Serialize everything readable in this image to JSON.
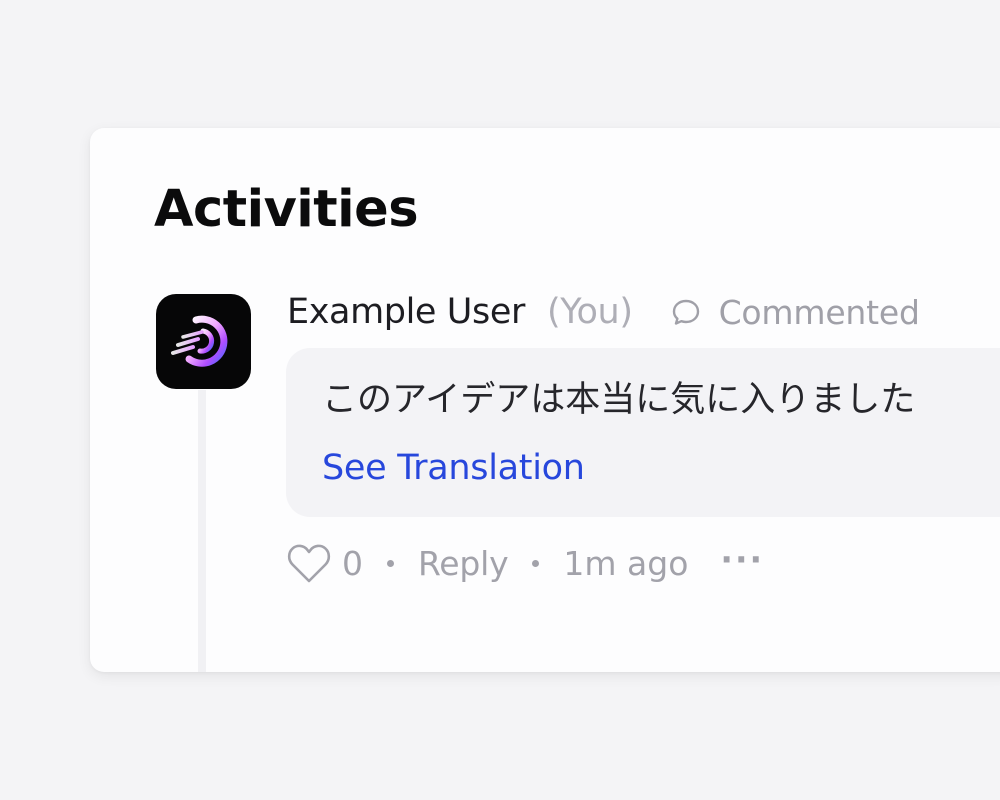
{
  "section": {
    "title": "Activities"
  },
  "activity": {
    "user_name": "Example User",
    "you_tag": "(You)",
    "action_icon": "comment-icon",
    "action_label": "Commented",
    "comment_text": "このアイデアは本当に気に入りました",
    "translate_label": "See Translation",
    "like_count": "0",
    "reply_label": "Reply",
    "timestamp": "1m ago",
    "more_label": "···"
  },
  "colors": {
    "page_background": "#f4f4f6",
    "card_background": "#fdfdfe",
    "bubble_background": "#f3f3f6",
    "link": "#2747dc",
    "muted_text": "#a2a2aa",
    "avatar_background": "#060607"
  }
}
